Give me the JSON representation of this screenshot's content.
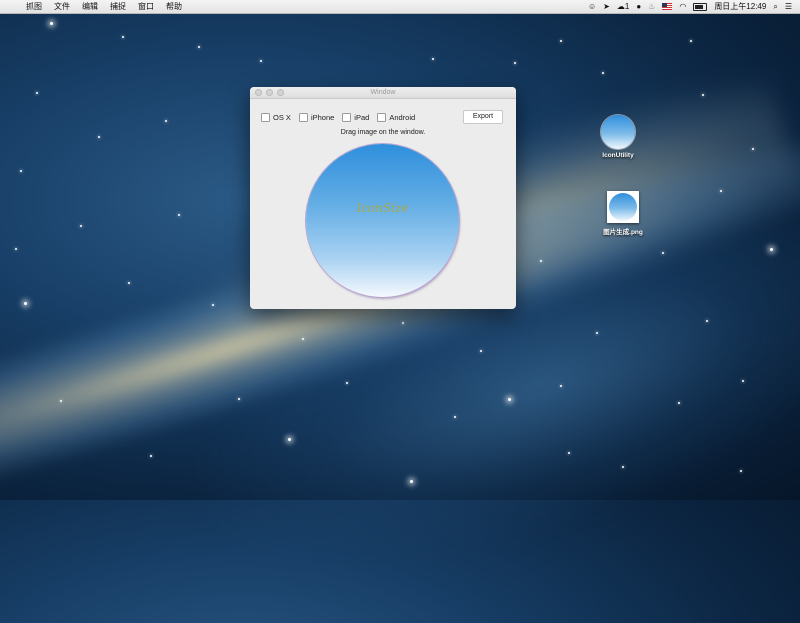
{
  "menubar": {
    "apple_icon": "apple-logo-icon",
    "menus": [
      "抓图",
      "文件",
      "编辑",
      "捕捉",
      "窗口",
      "帮助"
    ],
    "status_badge": "1",
    "clock": "周日上午12:49"
  },
  "window": {
    "title": "Window",
    "platforms": [
      {
        "label": "OS X",
        "checked": false
      },
      {
        "label": "iPhone",
        "checked": false
      },
      {
        "label": "iPad",
        "checked": false
      },
      {
        "label": "Android",
        "checked": false
      }
    ],
    "export_label": "Export",
    "hint": "Drag image on the window.",
    "drop_label": "IconSize"
  },
  "desktop": {
    "icons": [
      {
        "label": "IconUtility"
      },
      {
        "label": "图片生成.png"
      }
    ]
  }
}
